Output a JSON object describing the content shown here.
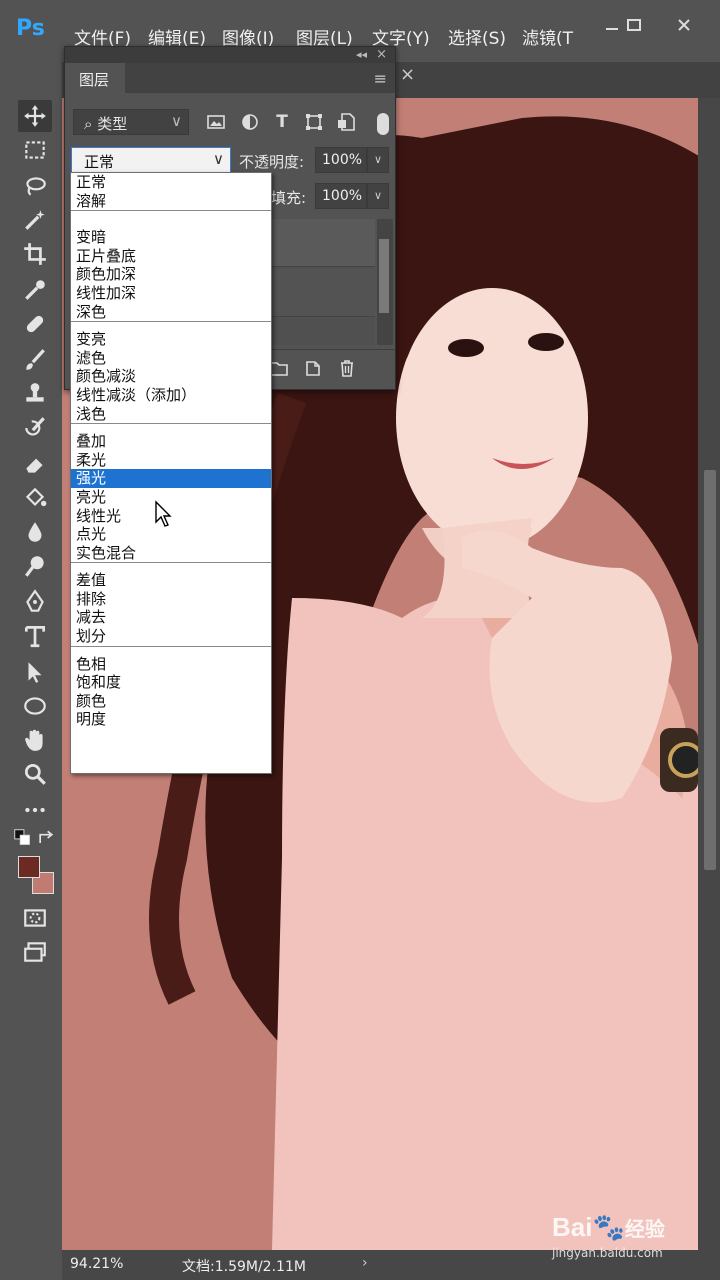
{
  "app": {
    "logo": "Ps",
    "menu": [
      "文件(F)",
      "编辑(E)",
      "图像(I)",
      "图层(L)",
      "文字(Y)",
      "选择(S)",
      "滤镜(T"
    ],
    "window_controls": [
      "minimize-icon",
      "maximize-icon",
      "close-icon"
    ]
  },
  "layers_panel": {
    "tab_label": "图层",
    "collapse_glyph": "◂◂",
    "close_glyph": "×",
    "menu_glyph": "≡",
    "filter": {
      "search_icon_glyph": "⌕",
      "value": "类型",
      "icons": [
        "image-filter-icon",
        "adjustment-filter-icon",
        "text-filter-icon",
        "shape-filter-icon",
        "smart-object-filter-icon"
      ],
      "text_icon_glyph": "T"
    },
    "blend_mode": "正常",
    "opacity_label": "不透明度:",
    "opacity_value": "100%",
    "fill_label": "填充:",
    "fill_value": "100%",
    "dropdown_glyph": "∨"
  },
  "blend_menu": {
    "selected": "强光",
    "groups": [
      [
        "正常",
        "溶解"
      ],
      [
        "变暗",
        "正片叠底",
        "颜色加深",
        "线性加深",
        "深色"
      ],
      [
        "变亮",
        "滤色",
        "颜色减淡",
        "线性减淡（添加）",
        "浅色"
      ],
      [
        "叠加",
        "柔光",
        "强光",
        "亮光",
        "线性光",
        "点光",
        "实色混合"
      ],
      [
        "差值",
        "排除",
        "减去",
        "划分"
      ],
      [
        "色相",
        "饱和度",
        "颜色",
        "明度"
      ]
    ]
  },
  "document": {
    "tab_close_glyph": "×",
    "canvas_color": "#c17f75"
  },
  "status": {
    "zoom": "94.21%",
    "doc_size": "文档:1.59M/2.11M",
    "arrow_glyph": "›"
  },
  "watermark": {
    "brand": "Bai",
    "brand_suffix": "经验",
    "url": "jingyan.baidu.com"
  },
  "colors": {
    "foreground": "#6b2a22",
    "background": "#c07c70",
    "selection": "#1e73d0",
    "ps_blue": "#31a8ff"
  }
}
